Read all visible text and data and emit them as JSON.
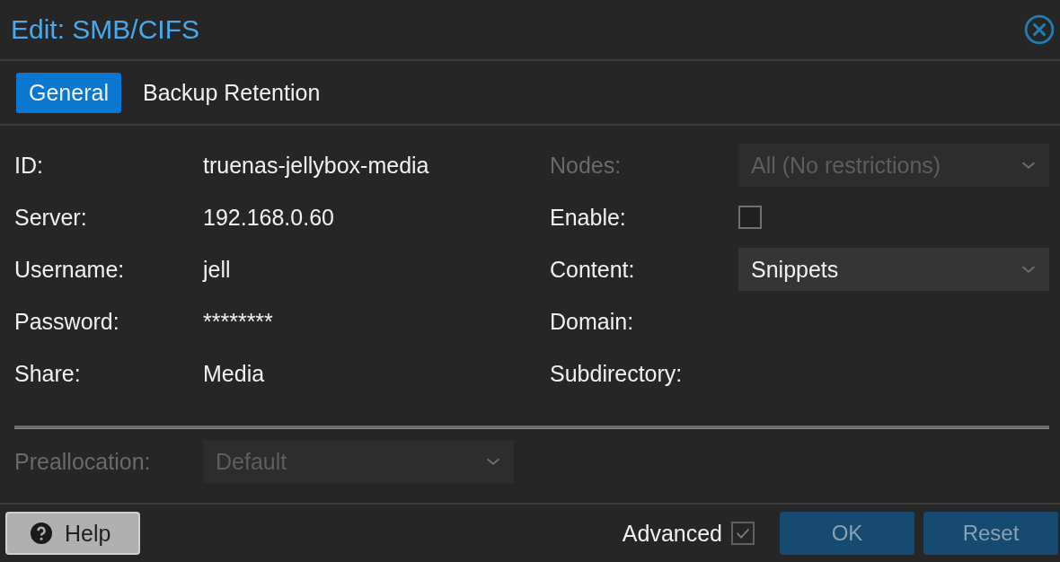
{
  "window": {
    "title": "Edit: SMB/CIFS"
  },
  "tabs": [
    {
      "label": "General",
      "selected": true
    },
    {
      "label": "Backup Retention",
      "selected": false
    }
  ],
  "left_fields": [
    {
      "label": "ID:",
      "value": "truenas-jellybox-media"
    },
    {
      "label": "Server:",
      "value": "192.168.0.60"
    },
    {
      "label": "Username:",
      "value": "jell"
    },
    {
      "label": "Password:",
      "value": "********"
    },
    {
      "label": "Share:",
      "value": "Media"
    }
  ],
  "right_fields": [
    {
      "kind": "combo",
      "label": "Nodes:",
      "value": "All (No restrictions)",
      "disabled": true
    },
    {
      "kind": "checkbox",
      "label": "Enable:",
      "checked": false
    },
    {
      "kind": "combo",
      "label": "Content:",
      "value": "Snippets",
      "disabled": false
    },
    {
      "kind": "text",
      "label": "Domain:"
    },
    {
      "kind": "text",
      "label": "Subdirectory:"
    }
  ],
  "advanced_fields": [
    {
      "kind": "combo",
      "label": "Preallocation:",
      "value": "Default",
      "disabled": true
    }
  ],
  "footer": {
    "help": "Help",
    "advanced": {
      "label": "Advanced",
      "checked": true
    },
    "buttons": [
      {
        "label": "OK",
        "disabled": true
      },
      {
        "label": "Reset",
        "disabled": true
      }
    ]
  }
}
